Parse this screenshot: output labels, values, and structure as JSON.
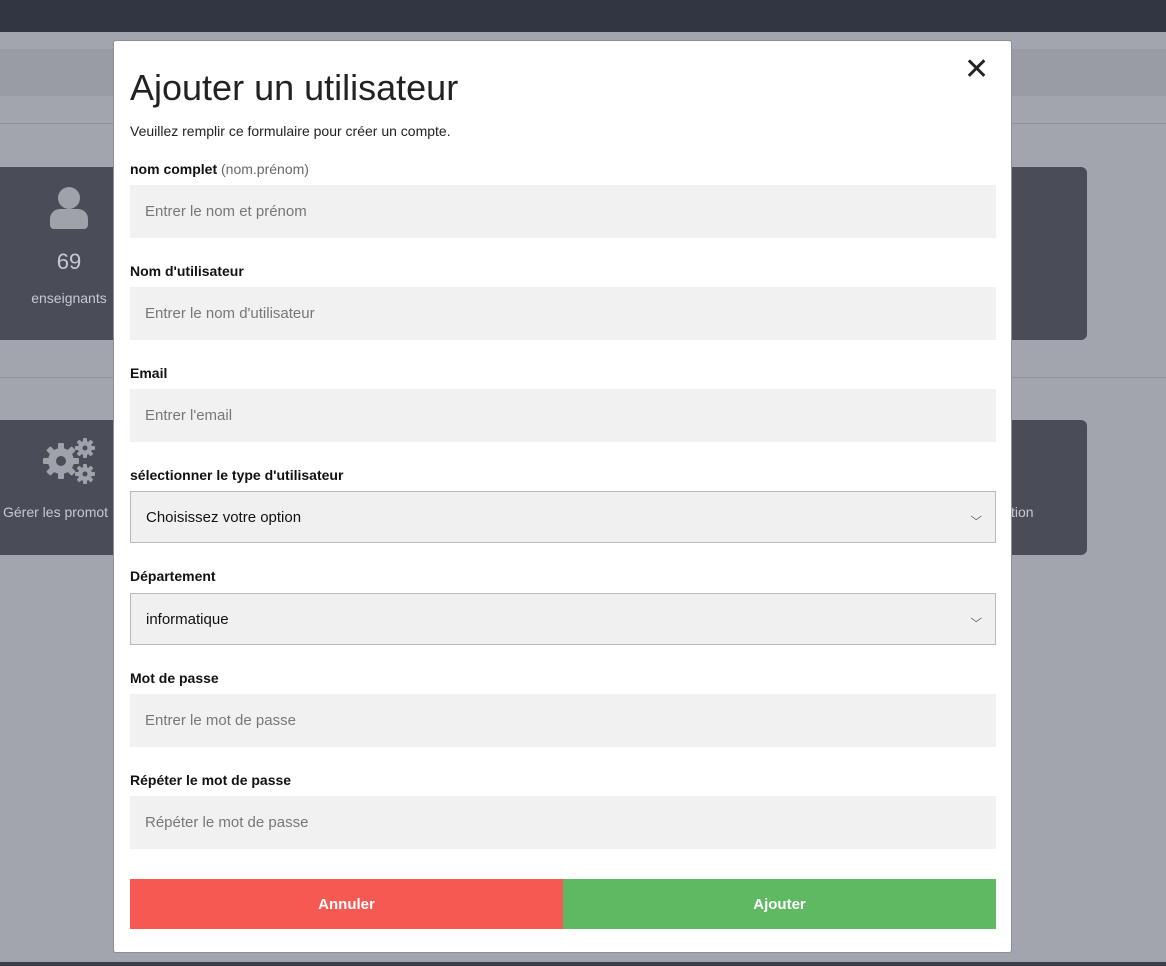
{
  "background": {
    "stat_card": {
      "icon": "user-icon",
      "number": "69",
      "label": "enseignants"
    },
    "manage_card": {
      "icon": "gears-icon",
      "label": "Gérer les promot"
    },
    "right_card_2": {
      "label": "tion"
    }
  },
  "modal": {
    "close_symbol": "✕",
    "title": "Ajouter un utilisateur",
    "subtitle": "Veuillez remplir ce formulaire pour créer un compte.",
    "fullname": {
      "label": "nom complet",
      "hint": "(nom.prénom)",
      "placeholder": "Entrer le nom et prénom"
    },
    "username": {
      "label": "Nom d'utilisateur",
      "placeholder": "Entrer le nom d'utilisateur"
    },
    "email": {
      "label": "Email",
      "placeholder": "Entrer l'email"
    },
    "user_type": {
      "label": "sélectionner le type d'utilisateur",
      "selected": "Choisissez votre option"
    },
    "department": {
      "label": "Département",
      "selected": "informatique"
    },
    "password": {
      "label": "Mot de passe",
      "placeholder": "Entrer le mot de passe"
    },
    "password_repeat": {
      "label": "Répéter le mot de passe",
      "placeholder": "Répéter le mot de passe"
    },
    "cancel_label": "Annuler",
    "submit_label": "Ajouter"
  },
  "colors": {
    "cancel": "#f65951",
    "submit": "#5fb962",
    "overlay": "#a3a5ae",
    "card": "#4a4d57"
  }
}
